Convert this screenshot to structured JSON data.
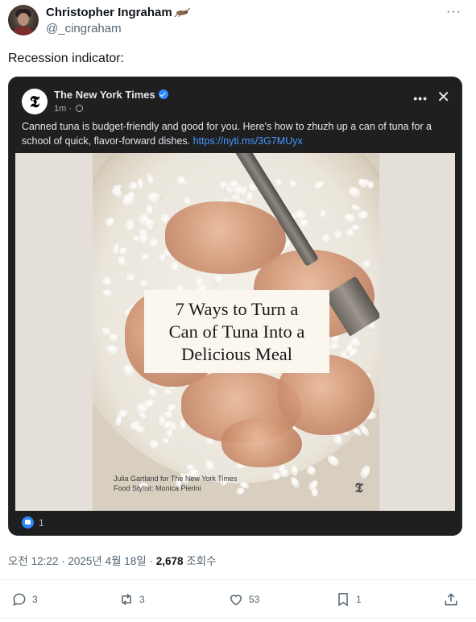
{
  "author": {
    "name": "Christopher Ingraham",
    "handle": "@_cingraham"
  },
  "tweet": {
    "text": "Recession indicator:",
    "meta_time": "오전 12:22 · 2025년 4월 18일 · ",
    "views_count": "2,678",
    "views_label": " 조회수"
  },
  "embed": {
    "page_name": "The New York Times",
    "logo_glyph": "𝕿",
    "time": "1m · ",
    "caption": "Canned tuna is budget-friendly and good for you. Here's how to zhuzh up a can of tuna for a school of quick, flavor-forward dishes. ",
    "link": "https://nyti.ms/3G7MUyx",
    "headline_lines": [
      "7 Ways to Turn a",
      "Can of Tuna Into a",
      "Delicious Meal"
    ],
    "credit_line1": "Julia Gartland for The New York Times",
    "credit_line2": "Food Stylist: Monica Pierini",
    "photo_logo": "𝕿",
    "reaction_count": "1",
    "more_label": "•••",
    "close_label": "✕"
  },
  "more_label": "···",
  "actions": {
    "reply_count": "3",
    "retweet_count": "3",
    "like_count": "53",
    "bookmark_count": "1"
  },
  "icons": {
    "reply": "reply-icon",
    "retweet": "retweet-icon",
    "like": "heart-icon",
    "bookmark": "bookmark-icon",
    "share": "share-icon"
  },
  "colors": {
    "link": "#4599ff",
    "verified": "#2d88ff",
    "secondary_text": "#536471"
  }
}
